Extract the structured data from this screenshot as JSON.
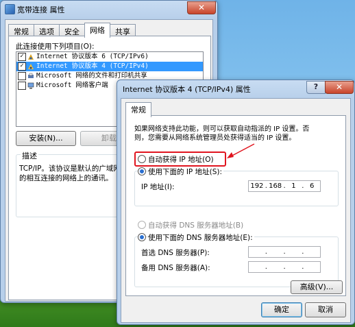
{
  "back_window": {
    "title": "宽带连接 属性",
    "close_glyph": "✕",
    "tabs": [
      "常规",
      "选项",
      "安全",
      "网络",
      "共享"
    ],
    "active_tab_index": 3,
    "items_label": "此连接使用下列项目(O):",
    "items": [
      {
        "text": "Internet 协议版本 6 (TCP/IPv6)",
        "checked": true,
        "selected": false,
        "check_mark": "✓"
      },
      {
        "text": "Internet 协议版本 4 (TCP/IPv4)",
        "checked": true,
        "selected": true,
        "check_mark": "✓"
      },
      {
        "text": "Microsoft 网络的文件和打印机共享",
        "checked": false,
        "selected": false,
        "check_mark": ""
      },
      {
        "text": "Microsoft 网络客户端",
        "checked": false,
        "selected": false,
        "check_mark": ""
      }
    ],
    "install_button": "安装(N)...",
    "uninstall_button": "卸载(",
    "description_title": "描述",
    "description_line1": "TCP/IP。该协议是默认的广域网",
    "description_line2": "的相互连接的网络上的通讯。"
  },
  "front_window": {
    "title": "Internet 协议版本 4 (TCP/IPv4) 属性",
    "help_glyph": "?",
    "close_glyph": "✕",
    "tab": "常规",
    "intro_line1": "如果网络支持此功能，则可以获取自动指派的 IP 设置。否",
    "intro_line2": "则，您需要从网络系统管理员处获得适当的 IP 设置。",
    "auto_ip_label": "自动获得 IP 地址(O)",
    "manual_ip_label": "使用下面的 IP 地址(S):",
    "ip_address_label": "IP 地址(I):",
    "ip_address": [
      "192",
      "168",
      "1",
      "6"
    ],
    "ip_dot": ".",
    "auto_dns_label": "自动获得 DNS 服务器地址(B)",
    "manual_dns_label": "使用下面的 DNS 服务器地址(E):",
    "preferred_dns_label": "首选 DNS 服务器(P):",
    "alternate_dns_label": "备用 DNS 服务器(A):",
    "advanced_button": "高级(V)...",
    "ok_button": "确定",
    "cancel_button": "取消"
  },
  "colors": {
    "annotation": "#e0141e",
    "selection": "#3399ff"
  }
}
